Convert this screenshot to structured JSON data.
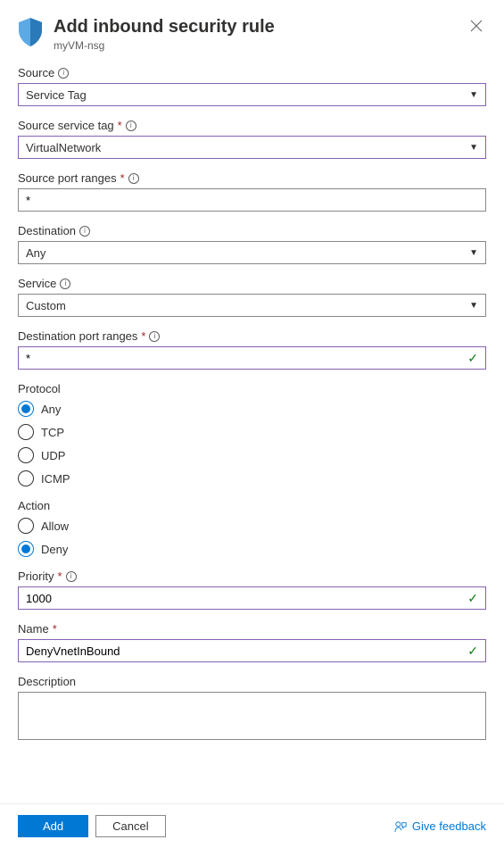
{
  "header": {
    "title": "Add inbound security rule",
    "subtitle": "myVM-nsg"
  },
  "fields": {
    "source": {
      "label": "Source",
      "value": "Service Tag"
    },
    "sourceServiceTag": {
      "label": "Source service tag",
      "value": "VirtualNetwork"
    },
    "sourcePortRanges": {
      "label": "Source port ranges",
      "value": "*"
    },
    "destination": {
      "label": "Destination",
      "value": "Any"
    },
    "service": {
      "label": "Service",
      "value": "Custom"
    },
    "destPortRanges": {
      "label": "Destination port ranges",
      "value": "*"
    },
    "protocol": {
      "label": "Protocol",
      "options": [
        "Any",
        "TCP",
        "UDP",
        "ICMP"
      ],
      "selected": "Any"
    },
    "action": {
      "label": "Action",
      "options": [
        "Allow",
        "Deny"
      ],
      "selected": "Deny"
    },
    "priority": {
      "label": "Priority",
      "value": "1000"
    },
    "name": {
      "label": "Name",
      "value": "DenyVnetInBound"
    },
    "description": {
      "label": "Description",
      "value": ""
    }
  },
  "footer": {
    "add": "Add",
    "cancel": "Cancel",
    "feedback": "Give feedback"
  }
}
